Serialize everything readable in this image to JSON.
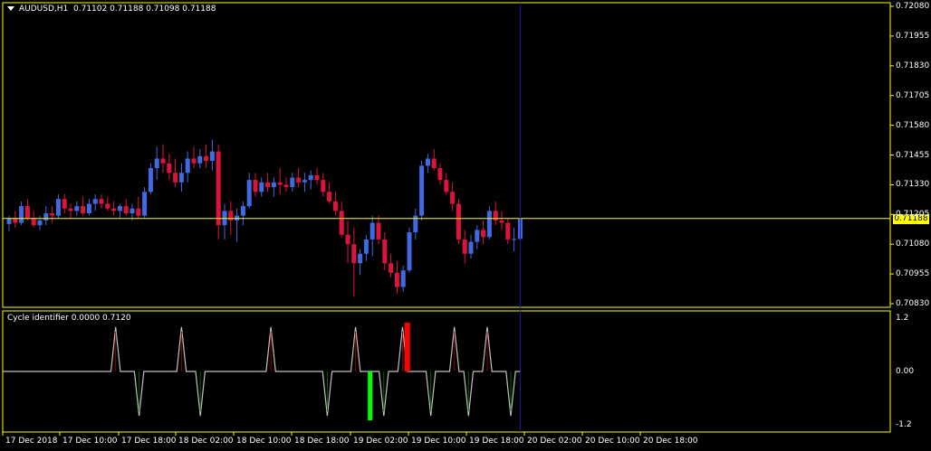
{
  "window": {
    "symbol": "AUDUSD,H1",
    "ohlc": "0.71102 0.71188 0.71098 0.71188",
    "current_price": "0.71188"
  },
  "price_axis": {
    "ticks": [
      "0.72080",
      "0.71955",
      "0.71830",
      "0.71705",
      "0.71580",
      "0.71455",
      "0.71330",
      "0.71205",
      "0.71080",
      "0.70955",
      "0.70830"
    ]
  },
  "indicator": {
    "title": "Cycle identifier 0.0000 0.7120",
    "ticks": [
      "1.2",
      "0.00",
      "-1.2"
    ]
  },
  "time_axis": {
    "labels": [
      "17 Dec 2018",
      "17 Dec 10:00",
      "17 Dec 18:00",
      "18 Dec 02:00",
      "18 Dec 10:00",
      "18 Dec 18:00",
      "19 Dec 02:00",
      "19 Dec 10:00",
      "19 Dec 18:00",
      "20 Dec 02:00",
      "20 Dec 10:00",
      "20 Dec 18:00"
    ]
  },
  "colors": {
    "background": "#000000",
    "bull": "#4169e1",
    "bear": "#dc143c",
    "frame": "#ffff00",
    "cycle_line": "#c0c0c0",
    "cycle_up_strong": "#ff0000",
    "cycle_down_strong": "#00ff00",
    "vline": "#1a1aa8"
  },
  "chart_data": {
    "type": "candlestick",
    "symbol": "AUDUSD",
    "timeframe": "H1",
    "ylim": [
      0.7083,
      0.7208
    ],
    "candles": [
      {
        "o": 0.71165,
        "h": 0.712,
        "l": 0.71135,
        "c": 0.7119
      },
      {
        "o": 0.7119,
        "h": 0.7122,
        "l": 0.7115,
        "c": 0.7117
      },
      {
        "o": 0.7117,
        "h": 0.7126,
        "l": 0.7116,
        "c": 0.7124
      },
      {
        "o": 0.7124,
        "h": 0.7127,
        "l": 0.7118,
        "c": 0.7119
      },
      {
        "o": 0.7119,
        "h": 0.7122,
        "l": 0.7115,
        "c": 0.7116
      },
      {
        "o": 0.7116,
        "h": 0.712,
        "l": 0.7114,
        "c": 0.7118
      },
      {
        "o": 0.7118,
        "h": 0.7124,
        "l": 0.7116,
        "c": 0.7121
      },
      {
        "o": 0.7121,
        "h": 0.7124,
        "l": 0.7117,
        "c": 0.712
      },
      {
        "o": 0.712,
        "h": 0.7129,
        "l": 0.7119,
        "c": 0.7127
      },
      {
        "o": 0.7127,
        "h": 0.7129,
        "l": 0.7121,
        "c": 0.7123
      },
      {
        "o": 0.7123,
        "h": 0.7125,
        "l": 0.7119,
        "c": 0.7122
      },
      {
        "o": 0.7122,
        "h": 0.7126,
        "l": 0.712,
        "c": 0.7124
      },
      {
        "o": 0.7124,
        "h": 0.7128,
        "l": 0.712,
        "c": 0.7121
      },
      {
        "o": 0.7121,
        "h": 0.7127,
        "l": 0.712,
        "c": 0.7125
      },
      {
        "o": 0.7125,
        "h": 0.7129,
        "l": 0.7122,
        "c": 0.7127
      },
      {
        "o": 0.7127,
        "h": 0.7129,
        "l": 0.7123,
        "c": 0.7125
      },
      {
        "o": 0.7125,
        "h": 0.7128,
        "l": 0.7122,
        "c": 0.7123
      },
      {
        "o": 0.7123,
        "h": 0.7126,
        "l": 0.712,
        "c": 0.7122
      },
      {
        "o": 0.7122,
        "h": 0.7125,
        "l": 0.7119,
        "c": 0.7124
      },
      {
        "o": 0.7124,
        "h": 0.7127,
        "l": 0.712,
        "c": 0.7121
      },
      {
        "o": 0.7121,
        "h": 0.7125,
        "l": 0.7118,
        "c": 0.7123
      },
      {
        "o": 0.7123,
        "h": 0.7128,
        "l": 0.7119,
        "c": 0.712
      },
      {
        "o": 0.712,
        "h": 0.7132,
        "l": 0.7119,
        "c": 0.713
      },
      {
        "o": 0.713,
        "h": 0.7142,
        "l": 0.7129,
        "c": 0.714
      },
      {
        "o": 0.714,
        "h": 0.7149,
        "l": 0.7135,
        "c": 0.7144
      },
      {
        "o": 0.7144,
        "h": 0.715,
        "l": 0.7138,
        "c": 0.7142
      },
      {
        "o": 0.7142,
        "h": 0.7146,
        "l": 0.7135,
        "c": 0.7138
      },
      {
        "o": 0.7138,
        "h": 0.7144,
        "l": 0.7132,
        "c": 0.7134
      },
      {
        "o": 0.7134,
        "h": 0.7142,
        "l": 0.713,
        "c": 0.7138
      },
      {
        "o": 0.7138,
        "h": 0.7147,
        "l": 0.7134,
        "c": 0.7144
      },
      {
        "o": 0.7144,
        "h": 0.7149,
        "l": 0.714,
        "c": 0.7142
      },
      {
        "o": 0.7142,
        "h": 0.7148,
        "l": 0.714,
        "c": 0.7145
      },
      {
        "o": 0.7145,
        "h": 0.715,
        "l": 0.714,
        "c": 0.7143
      },
      {
        "o": 0.7143,
        "h": 0.7152,
        "l": 0.7139,
        "c": 0.7147
      },
      {
        "o": 0.7147,
        "h": 0.715,
        "l": 0.711,
        "c": 0.7116
      },
      {
        "o": 0.7116,
        "h": 0.7125,
        "l": 0.711,
        "c": 0.7122
      },
      {
        "o": 0.7122,
        "h": 0.7126,
        "l": 0.7112,
        "c": 0.7118
      },
      {
        "o": 0.7118,
        "h": 0.7123,
        "l": 0.7109,
        "c": 0.712
      },
      {
        "o": 0.712,
        "h": 0.7126,
        "l": 0.7116,
        "c": 0.7124
      },
      {
        "o": 0.7124,
        "h": 0.7138,
        "l": 0.7123,
        "c": 0.7135
      },
      {
        "o": 0.7135,
        "h": 0.7138,
        "l": 0.7128,
        "c": 0.713
      },
      {
        "o": 0.713,
        "h": 0.7136,
        "l": 0.7128,
        "c": 0.7134
      },
      {
        "o": 0.7134,
        "h": 0.7138,
        "l": 0.713,
        "c": 0.7132
      },
      {
        "o": 0.7132,
        "h": 0.7136,
        "l": 0.7128,
        "c": 0.7134
      },
      {
        "o": 0.7134,
        "h": 0.714,
        "l": 0.7129,
        "c": 0.7133
      },
      {
        "o": 0.7133,
        "h": 0.7136,
        "l": 0.713,
        "c": 0.7132
      },
      {
        "o": 0.7132,
        "h": 0.7138,
        "l": 0.713,
        "c": 0.7136
      },
      {
        "o": 0.7136,
        "h": 0.714,
        "l": 0.7132,
        "c": 0.7134
      },
      {
        "o": 0.7134,
        "h": 0.7138,
        "l": 0.713,
        "c": 0.7135
      },
      {
        "o": 0.7135,
        "h": 0.7139,
        "l": 0.7131,
        "c": 0.7137
      },
      {
        "o": 0.7137,
        "h": 0.714,
        "l": 0.7133,
        "c": 0.7135
      },
      {
        "o": 0.7135,
        "h": 0.7138,
        "l": 0.7128,
        "c": 0.713
      },
      {
        "o": 0.713,
        "h": 0.7134,
        "l": 0.7125,
        "c": 0.7126
      },
      {
        "o": 0.7126,
        "h": 0.713,
        "l": 0.712,
        "c": 0.7122
      },
      {
        "o": 0.7122,
        "h": 0.7126,
        "l": 0.7111,
        "c": 0.7112
      },
      {
        "o": 0.7112,
        "h": 0.7118,
        "l": 0.71,
        "c": 0.7108
      },
      {
        "o": 0.7108,
        "h": 0.7115,
        "l": 0.7086,
        "c": 0.71
      },
      {
        "o": 0.71,
        "h": 0.7106,
        "l": 0.7095,
        "c": 0.7104
      },
      {
        "o": 0.7104,
        "h": 0.7112,
        "l": 0.7101,
        "c": 0.711
      },
      {
        "o": 0.711,
        "h": 0.712,
        "l": 0.7103,
        "c": 0.7117
      },
      {
        "o": 0.7117,
        "h": 0.712,
        "l": 0.7108,
        "c": 0.711
      },
      {
        "o": 0.711,
        "h": 0.7113,
        "l": 0.7097,
        "c": 0.71
      },
      {
        "o": 0.71,
        "h": 0.7104,
        "l": 0.7094,
        "c": 0.7096
      },
      {
        "o": 0.7096,
        "h": 0.7101,
        "l": 0.7087,
        "c": 0.709
      },
      {
        "o": 0.709,
        "h": 0.7099,
        "l": 0.7088,
        "c": 0.7097
      },
      {
        "o": 0.7097,
        "h": 0.7115,
        "l": 0.7096,
        "c": 0.7113
      },
      {
        "o": 0.7113,
        "h": 0.7123,
        "l": 0.711,
        "c": 0.712
      },
      {
        "o": 0.712,
        "h": 0.7143,
        "l": 0.7118,
        "c": 0.7141
      },
      {
        "o": 0.7141,
        "h": 0.7146,
        "l": 0.7138,
        "c": 0.7144
      },
      {
        "o": 0.7144,
        "h": 0.7148,
        "l": 0.7139,
        "c": 0.714
      },
      {
        "o": 0.714,
        "h": 0.7142,
        "l": 0.7133,
        "c": 0.7135
      },
      {
        "o": 0.7135,
        "h": 0.7138,
        "l": 0.7129,
        "c": 0.713
      },
      {
        "o": 0.713,
        "h": 0.7134,
        "l": 0.7122,
        "c": 0.7125
      },
      {
        "o": 0.7125,
        "h": 0.7127,
        "l": 0.7108,
        "c": 0.711
      },
      {
        "o": 0.711,
        "h": 0.7114,
        "l": 0.71,
        "c": 0.7104
      },
      {
        "o": 0.7104,
        "h": 0.7112,
        "l": 0.7102,
        "c": 0.7109
      },
      {
        "o": 0.7109,
        "h": 0.7116,
        "l": 0.7106,
        "c": 0.7114
      },
      {
        "o": 0.7114,
        "h": 0.7118,
        "l": 0.7108,
        "c": 0.7111
      },
      {
        "o": 0.7111,
        "h": 0.7124,
        "l": 0.711,
        "c": 0.7122
      },
      {
        "o": 0.7122,
        "h": 0.7126,
        "l": 0.7116,
        "c": 0.7118
      },
      {
        "o": 0.7118,
        "h": 0.7122,
        "l": 0.7114,
        "c": 0.7117
      },
      {
        "o": 0.7117,
        "h": 0.7119,
        "l": 0.7108,
        "c": 0.711
      },
      {
        "o": 0.711,
        "h": 0.7115,
        "l": 0.7105,
        "c": 0.71102
      },
      {
        "o": 0.71102,
        "h": 0.71188,
        "l": 0.71098,
        "c": 0.71188
      }
    ],
    "cycle_identifier": {
      "ylim": [
        -1.2,
        1.2
      ],
      "values": [
        0,
        0,
        0,
        0,
        0,
        0,
        0,
        0,
        0,
        0,
        0,
        0,
        0,
        0,
        0,
        0,
        0,
        0,
        0,
        0,
        0,
        0,
        0,
        0,
        1,
        0,
        0,
        0,
        0,
        -1,
        0,
        0,
        0,
        0,
        0,
        0,
        0,
        0,
        1,
        0,
        0,
        0,
        -1,
        0,
        0,
        0,
        0,
        0,
        0,
        0,
        0,
        0,
        0,
        0,
        0,
        0,
        0,
        1,
        0,
        0,
        0,
        0,
        0,
        0,
        0,
        0,
        0,
        0,
        0,
        -1,
        0,
        0,
        0,
        0,
        0,
        1,
        0,
        0,
        0,
        0,
        0,
        -1,
        0,
        0,
        0,
        1,
        0,
        0,
        0,
        0,
        0,
        -1,
        0,
        0,
        0,
        0,
        1,
        0,
        0,
        -1,
        0,
        0,
        0,
        1,
        0,
        0,
        0,
        0,
        -1,
        0,
        0
      ],
      "strong_up_index": 86,
      "strong_down_index": 78
    }
  }
}
